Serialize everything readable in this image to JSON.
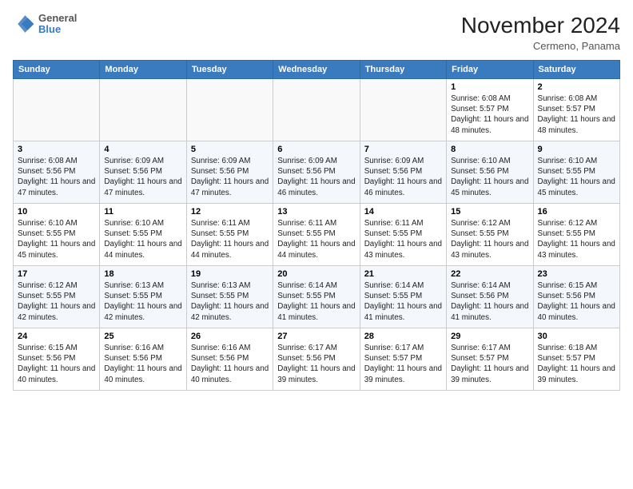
{
  "header": {
    "logo_line1": "General",
    "logo_line2": "Blue",
    "month_title": "November 2024",
    "location": "Cermeno, Panama"
  },
  "days_of_week": [
    "Sunday",
    "Monday",
    "Tuesday",
    "Wednesday",
    "Thursday",
    "Friday",
    "Saturday"
  ],
  "weeks": [
    [
      {
        "day": "",
        "info": ""
      },
      {
        "day": "",
        "info": ""
      },
      {
        "day": "",
        "info": ""
      },
      {
        "day": "",
        "info": ""
      },
      {
        "day": "",
        "info": ""
      },
      {
        "day": "1",
        "info": "Sunrise: 6:08 AM\nSunset: 5:57 PM\nDaylight: 11 hours and 48 minutes."
      },
      {
        "day": "2",
        "info": "Sunrise: 6:08 AM\nSunset: 5:57 PM\nDaylight: 11 hours and 48 minutes."
      }
    ],
    [
      {
        "day": "3",
        "info": "Sunrise: 6:08 AM\nSunset: 5:56 PM\nDaylight: 11 hours and 47 minutes."
      },
      {
        "day": "4",
        "info": "Sunrise: 6:09 AM\nSunset: 5:56 PM\nDaylight: 11 hours and 47 minutes."
      },
      {
        "day": "5",
        "info": "Sunrise: 6:09 AM\nSunset: 5:56 PM\nDaylight: 11 hours and 47 minutes."
      },
      {
        "day": "6",
        "info": "Sunrise: 6:09 AM\nSunset: 5:56 PM\nDaylight: 11 hours and 46 minutes."
      },
      {
        "day": "7",
        "info": "Sunrise: 6:09 AM\nSunset: 5:56 PM\nDaylight: 11 hours and 46 minutes."
      },
      {
        "day": "8",
        "info": "Sunrise: 6:10 AM\nSunset: 5:56 PM\nDaylight: 11 hours and 45 minutes."
      },
      {
        "day": "9",
        "info": "Sunrise: 6:10 AM\nSunset: 5:55 PM\nDaylight: 11 hours and 45 minutes."
      }
    ],
    [
      {
        "day": "10",
        "info": "Sunrise: 6:10 AM\nSunset: 5:55 PM\nDaylight: 11 hours and 45 minutes."
      },
      {
        "day": "11",
        "info": "Sunrise: 6:10 AM\nSunset: 5:55 PM\nDaylight: 11 hours and 44 minutes."
      },
      {
        "day": "12",
        "info": "Sunrise: 6:11 AM\nSunset: 5:55 PM\nDaylight: 11 hours and 44 minutes."
      },
      {
        "day": "13",
        "info": "Sunrise: 6:11 AM\nSunset: 5:55 PM\nDaylight: 11 hours and 44 minutes."
      },
      {
        "day": "14",
        "info": "Sunrise: 6:11 AM\nSunset: 5:55 PM\nDaylight: 11 hours and 43 minutes."
      },
      {
        "day": "15",
        "info": "Sunrise: 6:12 AM\nSunset: 5:55 PM\nDaylight: 11 hours and 43 minutes."
      },
      {
        "day": "16",
        "info": "Sunrise: 6:12 AM\nSunset: 5:55 PM\nDaylight: 11 hours and 43 minutes."
      }
    ],
    [
      {
        "day": "17",
        "info": "Sunrise: 6:12 AM\nSunset: 5:55 PM\nDaylight: 11 hours and 42 minutes."
      },
      {
        "day": "18",
        "info": "Sunrise: 6:13 AM\nSunset: 5:55 PM\nDaylight: 11 hours and 42 minutes."
      },
      {
        "day": "19",
        "info": "Sunrise: 6:13 AM\nSunset: 5:55 PM\nDaylight: 11 hours and 42 minutes."
      },
      {
        "day": "20",
        "info": "Sunrise: 6:14 AM\nSunset: 5:55 PM\nDaylight: 11 hours and 41 minutes."
      },
      {
        "day": "21",
        "info": "Sunrise: 6:14 AM\nSunset: 5:55 PM\nDaylight: 11 hours and 41 minutes."
      },
      {
        "day": "22",
        "info": "Sunrise: 6:14 AM\nSunset: 5:56 PM\nDaylight: 11 hours and 41 minutes."
      },
      {
        "day": "23",
        "info": "Sunrise: 6:15 AM\nSunset: 5:56 PM\nDaylight: 11 hours and 40 minutes."
      }
    ],
    [
      {
        "day": "24",
        "info": "Sunrise: 6:15 AM\nSunset: 5:56 PM\nDaylight: 11 hours and 40 minutes."
      },
      {
        "day": "25",
        "info": "Sunrise: 6:16 AM\nSunset: 5:56 PM\nDaylight: 11 hours and 40 minutes."
      },
      {
        "day": "26",
        "info": "Sunrise: 6:16 AM\nSunset: 5:56 PM\nDaylight: 11 hours and 40 minutes."
      },
      {
        "day": "27",
        "info": "Sunrise: 6:17 AM\nSunset: 5:56 PM\nDaylight: 11 hours and 39 minutes."
      },
      {
        "day": "28",
        "info": "Sunrise: 6:17 AM\nSunset: 5:57 PM\nDaylight: 11 hours and 39 minutes."
      },
      {
        "day": "29",
        "info": "Sunrise: 6:17 AM\nSunset: 5:57 PM\nDaylight: 11 hours and 39 minutes."
      },
      {
        "day": "30",
        "info": "Sunrise: 6:18 AM\nSunset: 5:57 PM\nDaylight: 11 hours and 39 minutes."
      }
    ]
  ]
}
